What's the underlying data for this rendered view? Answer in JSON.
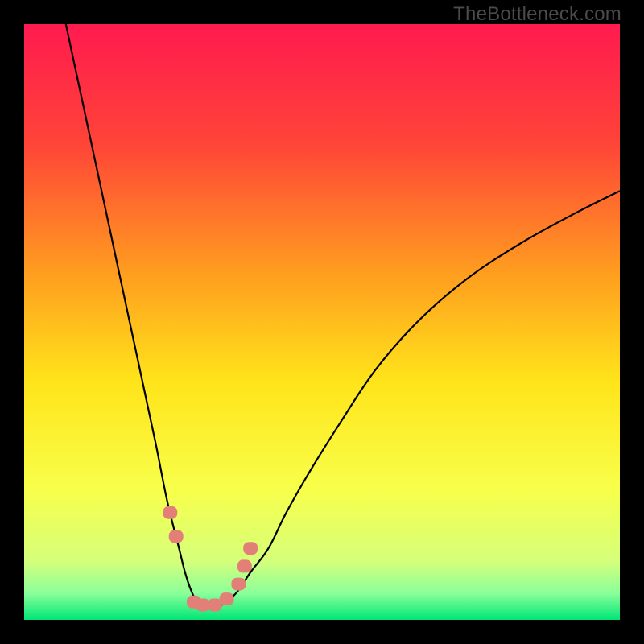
{
  "watermark": "TheBottleneck.com",
  "chart_data": {
    "type": "line",
    "title": "",
    "xlabel": "",
    "ylabel": "",
    "xlim": [
      0,
      100
    ],
    "ylim": [
      0,
      100
    ],
    "grid": false,
    "legend": false,
    "background_gradient": {
      "direction": "vertical",
      "stops": [
        {
          "pos": 0.0,
          "color": "#ff1a4f"
        },
        {
          "pos": 0.2,
          "color": "#ff4438"
        },
        {
          "pos": 0.42,
          "color": "#ff9e1f"
        },
        {
          "pos": 0.6,
          "color": "#ffe41a"
        },
        {
          "pos": 0.78,
          "color": "#f8ff4a"
        },
        {
          "pos": 0.9,
          "color": "#d6ff7a"
        },
        {
          "pos": 0.955,
          "color": "#8bff9a"
        },
        {
          "pos": 1.0,
          "color": "#00e676"
        }
      ]
    },
    "series": [
      {
        "name": "bottleneck-curve",
        "color": "#000000",
        "x": [
          7,
          10,
          13,
          16,
          19,
          22,
          24,
          26,
          27,
          28,
          29,
          30,
          31,
          32,
          34,
          36,
          38,
          41,
          44,
          48,
          53,
          59,
          66,
          74,
          83,
          92,
          100
        ],
        "y": [
          100,
          86,
          72,
          58,
          44,
          30,
          20,
          12,
          8,
          5,
          3,
          2,
          2,
          2,
          3,
          5,
          8,
          12,
          18,
          25,
          33,
          42,
          50,
          57,
          63,
          68,
          72
        ]
      }
    ],
    "markers": [
      {
        "name": "highlight-dots",
        "color": "#e28078",
        "shape": "rounded-rect",
        "x": [
          24.5,
          25.5,
          28.5,
          30.0,
          32.0,
          34.0,
          36.0,
          37.0,
          38.0
        ],
        "y": [
          18,
          14,
          3,
          2.5,
          2.5,
          3.5,
          6,
          9,
          12
        ]
      }
    ]
  }
}
